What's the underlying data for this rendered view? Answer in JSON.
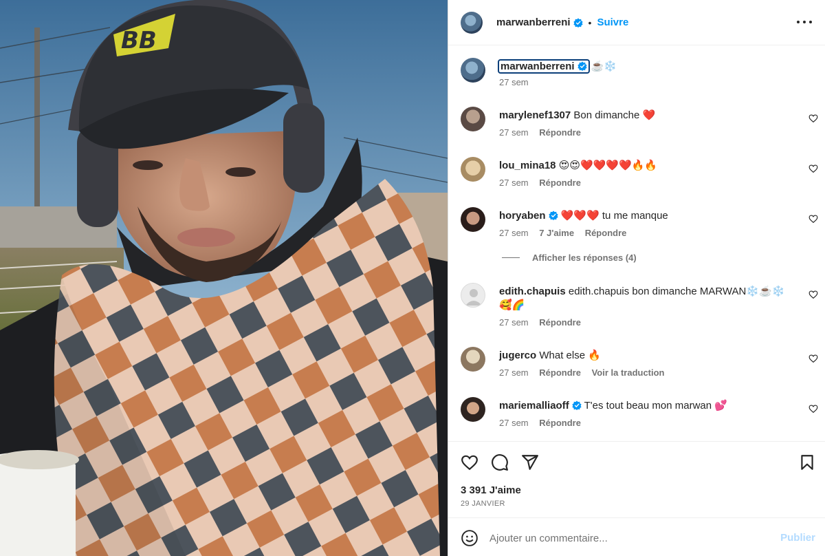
{
  "post": {
    "author": "marwanberreni",
    "follow_label": "Suivre",
    "separator": "•",
    "caption_text": "☕️❄️",
    "caption_time": "27 sem",
    "likes": "3 391 J'aime",
    "date": "29 JANVIER"
  },
  "comments": [
    {
      "user": "marylenef1307",
      "verified": false,
      "text": "Bon dimanche ❤️",
      "time": "27 sem",
      "likes": "",
      "reply": "Répondre",
      "translate": ""
    },
    {
      "user": "lou_mina18",
      "verified": false,
      "text": "😍😍❤️❤️❤️❤️🔥🔥",
      "time": "27 sem",
      "likes": "",
      "reply": "Répondre",
      "translate": ""
    },
    {
      "user": "horyaben",
      "verified": true,
      "text": "❤️❤️❤️ tu me manque",
      "time": "27 sem",
      "likes": "7 J'aime",
      "reply": "Répondre",
      "translate": ""
    },
    {
      "user": "edith.chapuis",
      "verified": false,
      "text": "edith.chapuis bon dimanche MARWAN❄️☕️❄️🥰🌈",
      "time": "27 sem",
      "likes": "",
      "reply": "Répondre",
      "translate": ""
    },
    {
      "user": "jugerco",
      "verified": false,
      "text": "What else 🔥",
      "time": "27 sem",
      "likes": "",
      "reply": "Répondre",
      "translate": "Voir la traduction"
    },
    {
      "user": "mariemalliaoff",
      "verified": true,
      "text": "T'es tout beau mon marwan 💕",
      "time": "27 sem",
      "likes": "",
      "reply": "Répondre",
      "translate": ""
    }
  ],
  "view_replies": "Afficher les réponses (4)",
  "add_comment": {
    "placeholder": "Ajouter un commentaire...",
    "publish": "Publier"
  },
  "cap_logo": "BB",
  "icons": {
    "more": "more-options-icon",
    "like": "heart-icon",
    "comment": "comment-bubble-icon",
    "share": "paper-plane-icon",
    "save": "bookmark-icon",
    "emoji": "emoji-smile-icon",
    "verified": "verified-badge-icon"
  },
  "colors": {
    "accent": "#0095f6",
    "verified": "#0095f6",
    "publish_disabled": "#b3dbff",
    "muted": "#737373",
    "text": "#262626"
  }
}
